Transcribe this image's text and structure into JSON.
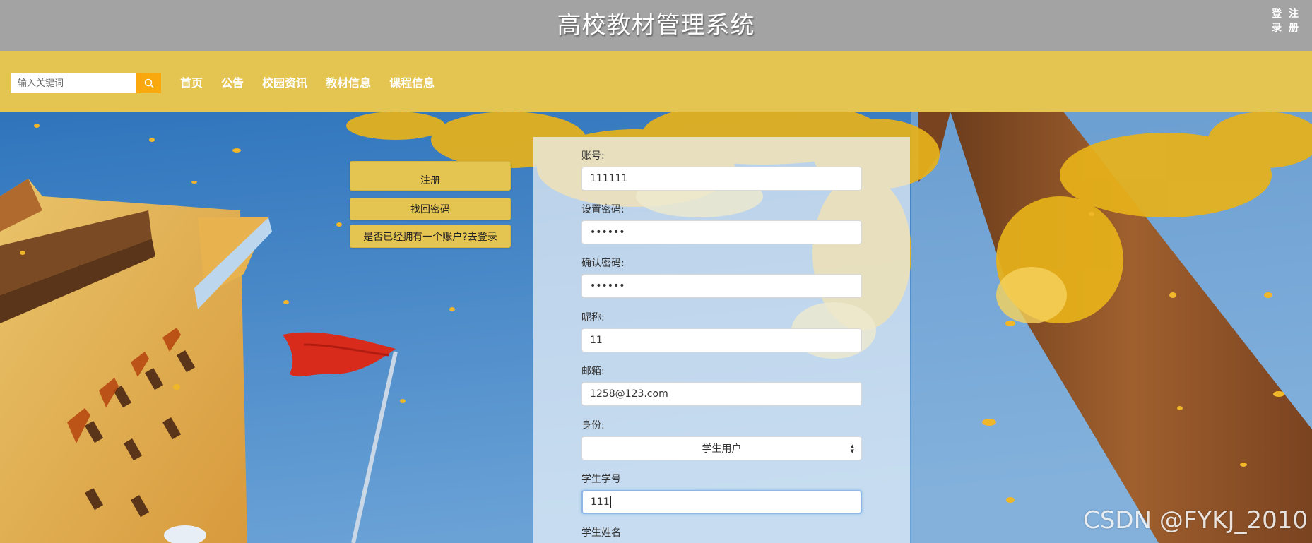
{
  "header": {
    "title": "高校教材管理系统",
    "auth_links": [
      {
        "label": "登录"
      },
      {
        "label": "注册"
      }
    ]
  },
  "navbar": {
    "search_placeholder": "输入关键词",
    "search_icon": "search-icon",
    "items": [
      {
        "label": "首页"
      },
      {
        "label": "公告"
      },
      {
        "label": "校园资讯"
      },
      {
        "label": "教材信息"
      },
      {
        "label": "课程信息"
      }
    ]
  },
  "side_buttons": {
    "register": "注册",
    "forgot_password": "找回密码",
    "have_account": "是否已经拥有一个账户?去登录"
  },
  "form": {
    "account": {
      "label": "账号:",
      "value": "111111"
    },
    "password": {
      "label": "设置密码:",
      "value": "••••••"
    },
    "confirm_password": {
      "label": "确认密码:",
      "value": "••••••"
    },
    "nickname": {
      "label": "昵称:",
      "value": "11"
    },
    "email": {
      "label": "邮箱:",
      "value": "1258@123.com"
    },
    "identity": {
      "label": "身份:",
      "value": "学生用户"
    },
    "student_id": {
      "label": "学生学号",
      "value": "111"
    },
    "student_name": {
      "label": "学生姓名"
    }
  },
  "watermark": "CSDN @FYKJ_2010",
  "colors": {
    "header_bg": "#a3a3a3",
    "nav_bg": "#e5c552",
    "search_button": "#f9a80e",
    "sky": "#3d7fc2",
    "panel": "#ebf2fa"
  }
}
